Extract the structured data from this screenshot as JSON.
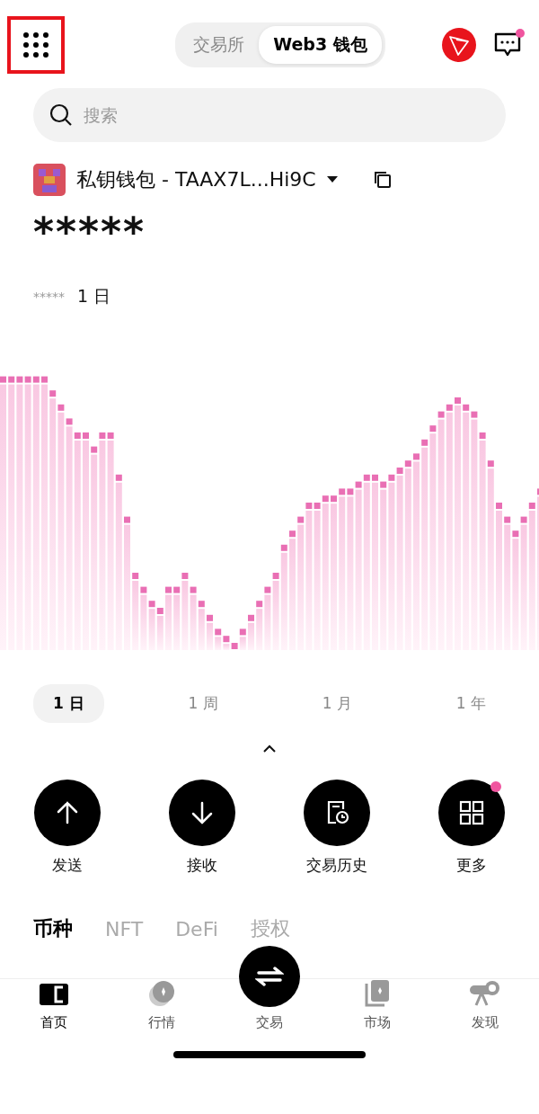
{
  "header": {
    "segments": [
      {
        "label": "交易所",
        "selected": false
      },
      {
        "label": "Web3 钱包",
        "selected": true
      }
    ],
    "message_badge": true
  },
  "search": {
    "placeholder": "搜索"
  },
  "wallet": {
    "name": "私钥钱包 - TAAX7L...Hi9C",
    "balance": "*****",
    "change": "*****",
    "period": "1 日"
  },
  "ranges": [
    {
      "label": "1 日",
      "selected": true
    },
    {
      "label": "1 周",
      "selected": false
    },
    {
      "label": "1 月",
      "selected": false
    },
    {
      "label": "1 年",
      "selected": false
    }
  ],
  "actions": [
    {
      "label": "发送",
      "kind": "send",
      "badge": false
    },
    {
      "label": "接收",
      "kind": "receive",
      "badge": false
    },
    {
      "label": "交易历史",
      "kind": "history",
      "badge": false
    },
    {
      "label": "更多",
      "kind": "more",
      "badge": true
    }
  ],
  "asset_tabs": [
    {
      "label": "币种",
      "selected": true
    },
    {
      "label": "NFT",
      "selected": false
    },
    {
      "label": "DeFi",
      "selected": false
    },
    {
      "label": "授权",
      "selected": false
    }
  ],
  "nav": [
    {
      "label": "首页",
      "kind": "home",
      "selected": true
    },
    {
      "label": "行情",
      "kind": "market",
      "selected": false
    },
    {
      "label": "交易",
      "kind": "trade",
      "selected": false
    },
    {
      "label": "市场",
      "kind": "shop",
      "selected": false
    },
    {
      "label": "发现",
      "kind": "discover",
      "selected": false
    }
  ]
}
